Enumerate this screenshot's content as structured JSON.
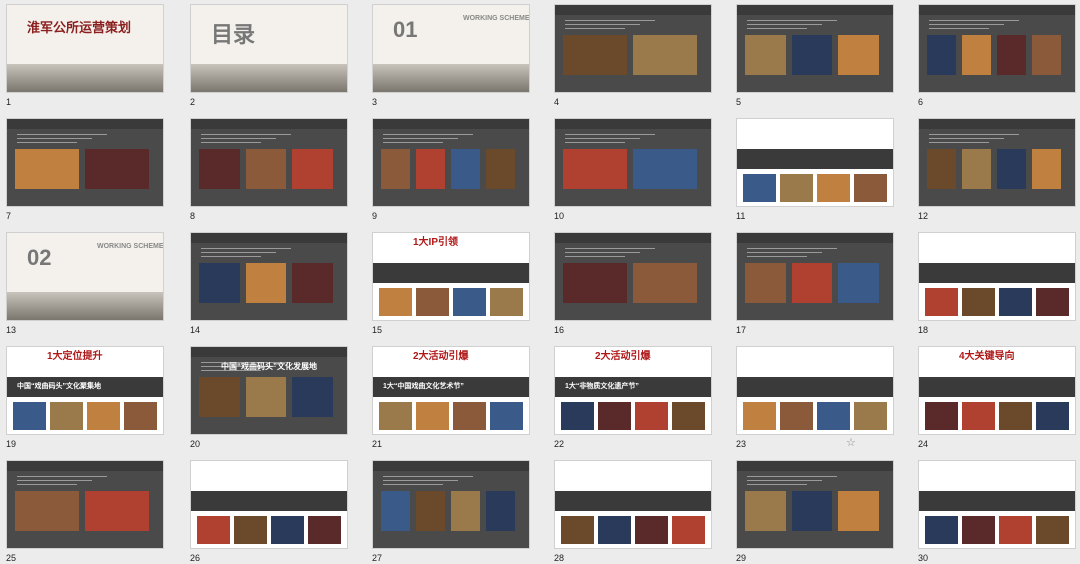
{
  "slides": [
    {
      "num": "1",
      "title": "淮军公所运营策划"
    },
    {
      "num": "2",
      "title": "目录"
    },
    {
      "num": "3",
      "title": "01",
      "subtitle": "WORKING SCHEME"
    },
    {
      "num": "4"
    },
    {
      "num": "5"
    },
    {
      "num": "6"
    },
    {
      "num": "7"
    },
    {
      "num": "8"
    },
    {
      "num": "9"
    },
    {
      "num": "10"
    },
    {
      "num": "11"
    },
    {
      "num": "12"
    },
    {
      "num": "13",
      "title": "02",
      "subtitle": "WORKING SCHEME"
    },
    {
      "num": "14"
    },
    {
      "num": "15",
      "title": "1大IP引领"
    },
    {
      "num": "16"
    },
    {
      "num": "17"
    },
    {
      "num": "18"
    },
    {
      "num": "19",
      "title": "1大定位提升",
      "subtitle": "中国“戏曲码头”文化聚集地"
    },
    {
      "num": "20",
      "title": "中国“戏曲码头”文化发展地"
    },
    {
      "num": "21",
      "title": "2大活动引爆",
      "subtitle": "1大“中国戏曲文化艺术节”"
    },
    {
      "num": "22",
      "title": "2大活动引爆",
      "subtitle": "1大“非物质文化遗产节”"
    },
    {
      "num": "23"
    },
    {
      "num": "24",
      "title": "4大关键导向"
    },
    {
      "num": "25"
    },
    {
      "num": "26"
    },
    {
      "num": "27"
    },
    {
      "num": "28"
    },
    {
      "num": "29"
    },
    {
      "num": "30"
    }
  ],
  "star_icon": "☆"
}
